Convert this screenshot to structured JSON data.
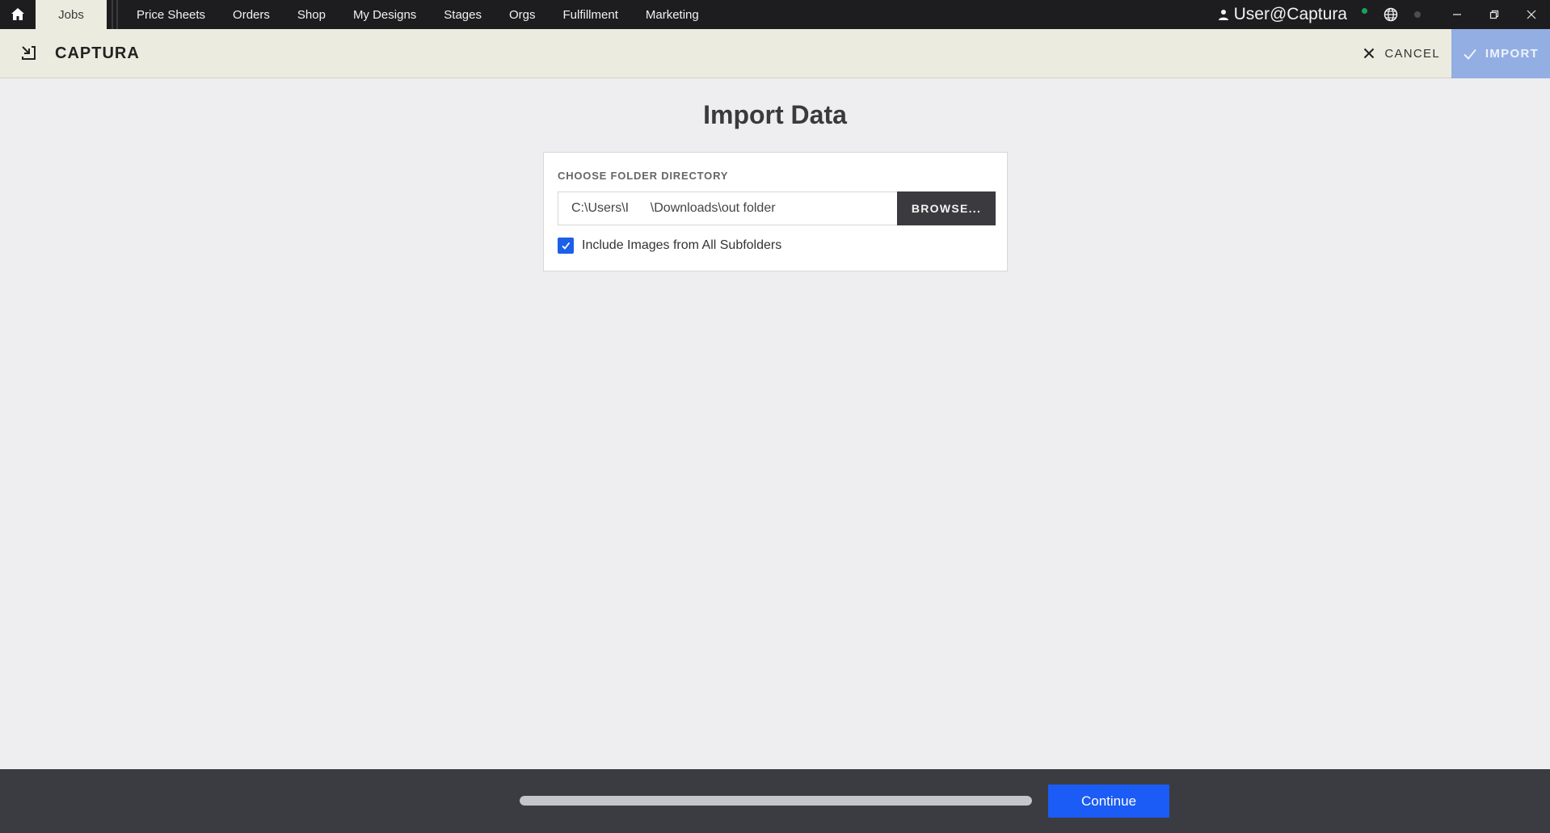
{
  "nav": {
    "tabs": [
      {
        "label": "Jobs"
      },
      {
        "label": "Price Sheets"
      },
      {
        "label": "Orders"
      },
      {
        "label": "Shop"
      },
      {
        "label": "My Designs"
      },
      {
        "label": "Stages"
      },
      {
        "label": "Orgs"
      },
      {
        "label": "Fulfillment"
      },
      {
        "label": "Marketing"
      }
    ],
    "active_tab": "Jobs",
    "user": "User@Captura"
  },
  "header": {
    "brand": "CAPTURA",
    "cancel_label": "CANCEL",
    "import_label": "IMPORT"
  },
  "main": {
    "title": "Import Data",
    "folder_label": "CHOOSE FOLDER DIRECTORY",
    "folder_path": "C:\\Users\\I      \\Downloads\\out folder",
    "browse_label": "BROWSE...",
    "include_subfolders": {
      "label": "Include Images from All Subfolders",
      "checked": true
    }
  },
  "footer": {
    "progress": 1.0,
    "continue_label": "Continue"
  },
  "colors": {
    "accent": "#1a5cf5",
    "import_button": "#93aee3",
    "topbar": "#1d1d1f",
    "subheader": "#ecebdf",
    "footer": "#3b3c41"
  }
}
